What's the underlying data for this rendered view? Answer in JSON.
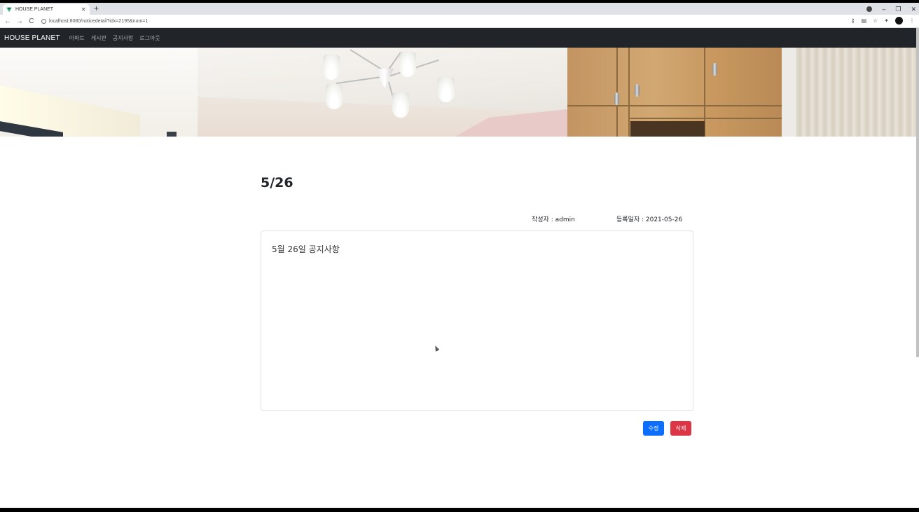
{
  "browser": {
    "tab_title": "HOUSE PLANET",
    "tab_close": "×",
    "new_tab": "+",
    "url": "localhost:8080/noticedetail?idx=2195&num=1",
    "back": "←",
    "forward": "→",
    "reload": "C",
    "minimize": "–",
    "restore": "❐",
    "close": "✕"
  },
  "navbar": {
    "brand": "HOUSE PLANET",
    "links": [
      "아파트",
      "게시판",
      "공지사항",
      "로그아웃"
    ]
  },
  "notice": {
    "title": "5/26",
    "author_label": "작성자 : admin",
    "date_label": "등록일자 : 2021-05-26",
    "content": "5월 26일 공지사항"
  },
  "actions": {
    "edit_label": "수정",
    "delete_label": "삭제"
  },
  "colors": {
    "navbar_bg": "#212529",
    "edit_button": "#0d6efd",
    "delete_button": "#dc3545"
  }
}
